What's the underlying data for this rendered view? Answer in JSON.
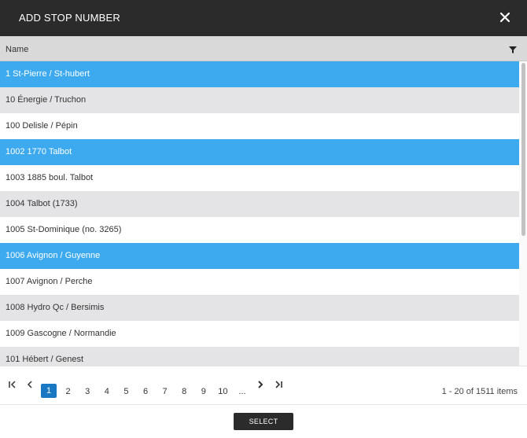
{
  "dialog": {
    "title": "ADD STOP NUMBER",
    "close_icon": "close-icon"
  },
  "grid": {
    "column_header": "Name",
    "filter_icon": "filter-icon",
    "rows": [
      {
        "label": "1 St-Pierre / St-hubert",
        "selected": true
      },
      {
        "label": "10 Énergie / Truchon",
        "selected": false
      },
      {
        "label": "100 Delisle / Pépin",
        "selected": false
      },
      {
        "label": "1002 1770 Talbot",
        "selected": true
      },
      {
        "label": "1003 1885 boul. Talbot",
        "selected": false
      },
      {
        "label": "1004 Talbot (1733)",
        "selected": false
      },
      {
        "label": "1005 St-Dominique (no. 3265)",
        "selected": false
      },
      {
        "label": "1006 Avignon / Guyenne",
        "selected": true
      },
      {
        "label": "1007 Avignon / Perche",
        "selected": false
      },
      {
        "label": "1008 Hydro Qc / Bersimis",
        "selected": false
      },
      {
        "label": "1009 Gascogne / Normandie",
        "selected": false
      },
      {
        "label": "101 Hébert / Genest",
        "selected": false
      }
    ]
  },
  "pager": {
    "pages": [
      "1",
      "2",
      "3",
      "4",
      "5",
      "6",
      "7",
      "8",
      "9",
      "10",
      "..."
    ],
    "current_page": "1",
    "info": "1 - 20 of 1511 items"
  },
  "footer": {
    "select_label": "SELECT"
  },
  "colors": {
    "titlebar": "#2b2b2b",
    "selected_row": "#3daaf0",
    "current_page": "#1a78c2"
  }
}
